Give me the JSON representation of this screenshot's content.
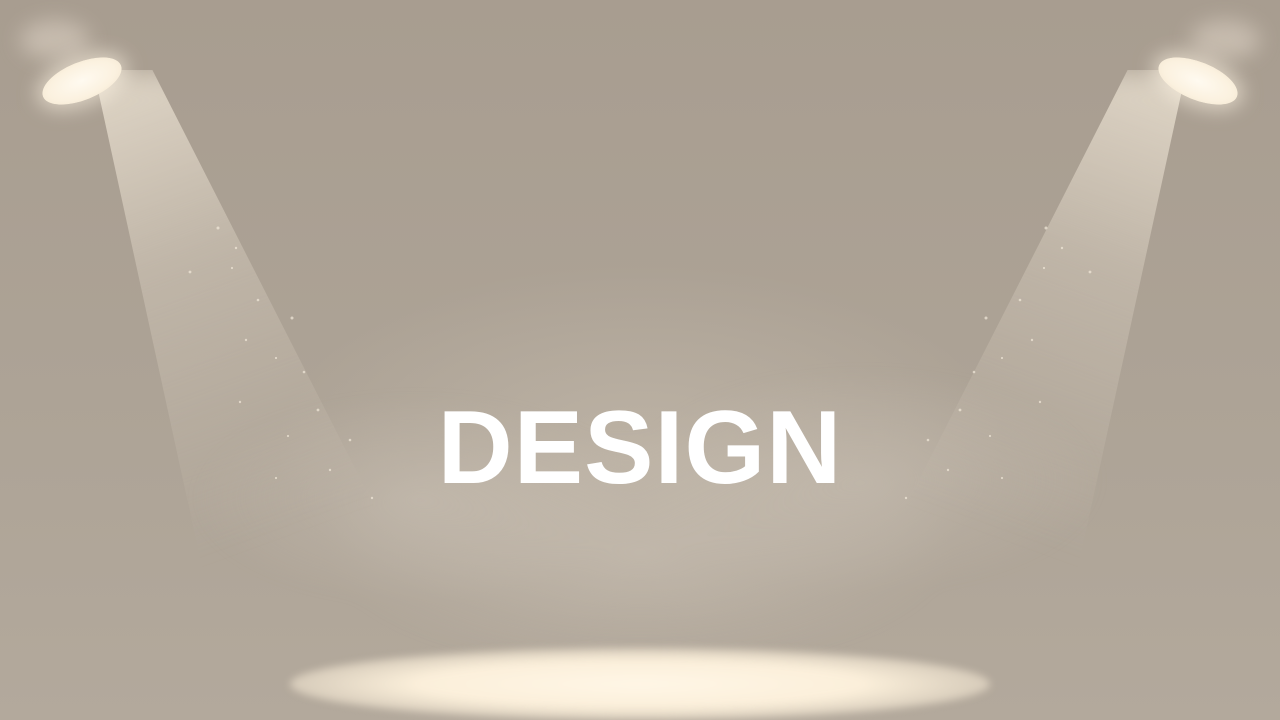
{
  "slide": {
    "title": "DESIGN"
  },
  "colors": {
    "background": "#a99e91",
    "light": "#fbf1df",
    "title": "#ffffff"
  }
}
